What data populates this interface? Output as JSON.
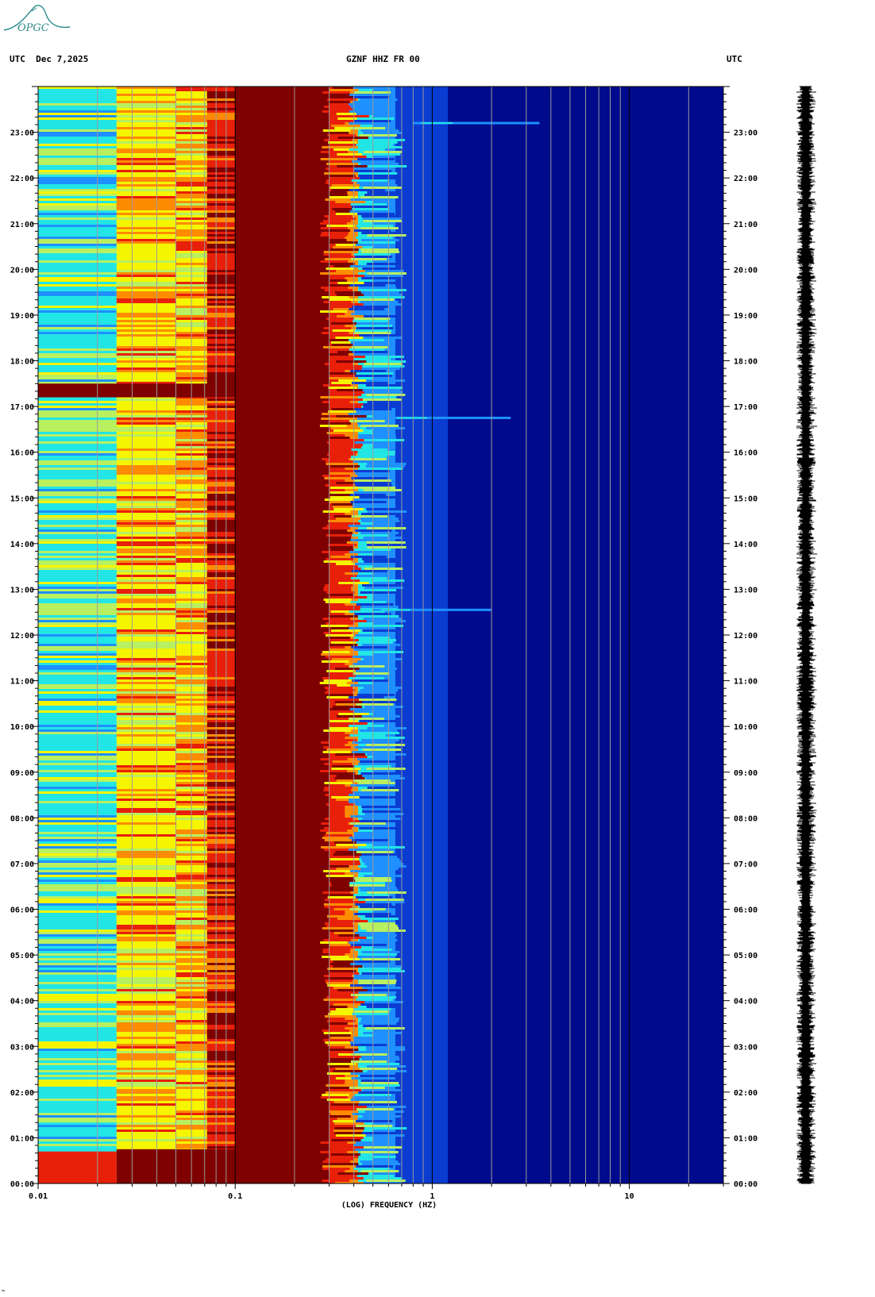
{
  "header": {
    "left": "UTC  Dec 7,2025",
    "center": "GZNF HHZ FR 00",
    "right": "UTC"
  },
  "logo": {
    "text": "OPGC"
  },
  "footer": {
    "mark": "\""
  },
  "colors": {
    "deep_red": "#7f0000",
    "red": "#e8200a",
    "orange": "#ff8c00",
    "yellow": "#f5f500",
    "green_yellow": "#b8f060",
    "cyan": "#22e6e6",
    "light_blue": "#1e90ff",
    "blue": "#0a3cd2",
    "dark_blue": "#00049a",
    "navy": "#000a8c"
  },
  "chart_data": {
    "type": "heatmap",
    "title": "GZNF HHZ FR 00",
    "xlabel": "(LOG) FREQUENCY (HZ)",
    "ylabel": "UTC",
    "x_scale": "log",
    "xlim": [
      0.01,
      30
    ],
    "x_ticks": [
      {
        "value": 0.01,
        "label": "0.01"
      },
      {
        "value": 0.1,
        "label": "0.1"
      },
      {
        "value": 1,
        "label": "1"
      },
      {
        "value": 10,
        "label": "10"
      }
    ],
    "y_unit": "hours UTC",
    "ylim": [
      0,
      24
    ],
    "y_ticks": [
      {
        "value": 0,
        "label": "00:00"
      },
      {
        "value": 1,
        "label": "01:00"
      },
      {
        "value": 2,
        "label": "02:00"
      },
      {
        "value": 3,
        "label": "03:00"
      },
      {
        "value": 4,
        "label": "04:00"
      },
      {
        "value": 5,
        "label": "05:00"
      },
      {
        "value": 6,
        "label": "06:00"
      },
      {
        "value": 7,
        "label": "07:00"
      },
      {
        "value": 8,
        "label": "08:00"
      },
      {
        "value": 9,
        "label": "09:00"
      },
      {
        "value": 10,
        "label": "10:00"
      },
      {
        "value": 11,
        "label": "11:00"
      },
      {
        "value": 12,
        "label": "12:00"
      },
      {
        "value": 13,
        "label": "13:00"
      },
      {
        "value": 14,
        "label": "14:00"
      },
      {
        "value": 15,
        "label": "15:00"
      },
      {
        "value": 16,
        "label": "16:00"
      },
      {
        "value": 17,
        "label": "17:00"
      },
      {
        "value": 18,
        "label": "18:00"
      },
      {
        "value": 19,
        "label": "19:00"
      },
      {
        "value": 20,
        "label": "20:00"
      },
      {
        "value": 21,
        "label": "21:00"
      },
      {
        "value": 22,
        "label": "22:00"
      },
      {
        "value": 23,
        "label": "23:00"
      }
    ],
    "frequency_bands_hz": [
      {
        "from": 0.01,
        "to": 0.025,
        "color": "cyan"
      },
      {
        "from": 0.025,
        "to": 0.05,
        "color": "yellow"
      },
      {
        "from": 0.05,
        "to": 0.072,
        "color": "yellow"
      },
      {
        "from": 0.072,
        "to": 0.1,
        "color": "red"
      },
      {
        "from": 0.1,
        "to": 0.3,
        "color": "deep_red"
      },
      {
        "from": 0.3,
        "to": 0.36,
        "color": "red"
      },
      {
        "from": 0.36,
        "to": 0.42,
        "color": "orange"
      },
      {
        "from": 0.42,
        "to": 0.5,
        "color": "cyan"
      },
      {
        "from": 0.5,
        "to": 0.65,
        "color": "light_blue"
      },
      {
        "from": 0.65,
        "to": 1.2,
        "color": "blue"
      },
      {
        "from": 1.2,
        "to": 30,
        "color": "navy"
      }
    ],
    "events": [
      {
        "time_h": 23.2,
        "from_hz": 0.8,
        "to_hz": 3.5
      },
      {
        "time_h": 16.75,
        "from_hz": 0.6,
        "to_hz": 2.5
      },
      {
        "time_h": 12.55,
        "from_hz": 0.5,
        "to_hz": 2.0
      }
    ],
    "high_power_period_h": [
      17.2,
      17.5
    ],
    "grid": true
  }
}
